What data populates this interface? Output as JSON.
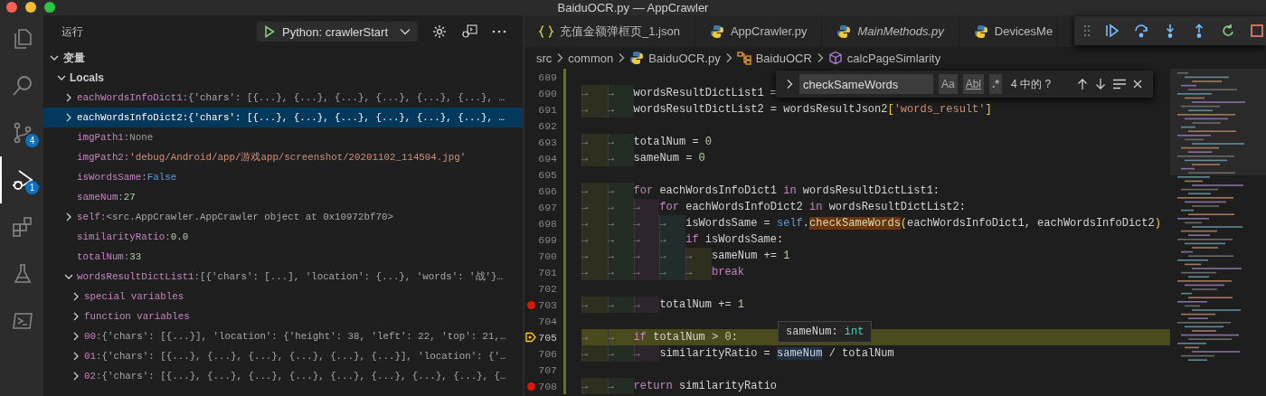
{
  "window": {
    "title": "BaiduOCR.py — AppCrawler"
  },
  "activity_bar": [
    {
      "kind": "files",
      "selected": false
    },
    {
      "kind": "search",
      "selected": false
    },
    {
      "kind": "source-control",
      "selected": false,
      "badge": "4"
    },
    {
      "kind": "run-debug",
      "selected": true,
      "badge": "1"
    },
    {
      "kind": "extensions",
      "selected": false
    },
    {
      "kind": "testing",
      "selected": false
    },
    {
      "kind": "remote",
      "selected": false
    }
  ],
  "run_view": {
    "title": "运行",
    "config": "Python: crawlerStart"
  },
  "variables": {
    "title": "变量",
    "expanded": true,
    "scopes": [
      {
        "name": "Locals",
        "kind": "scope",
        "expandable": true,
        "expanded": true,
        "selected": false,
        "children": [
          {
            "name": "eachWordsInfoDict1:",
            "value": "{'chars': [{...}, {...}, {...}, {...}, {...}, {...}, …",
            "kind": "object",
            "expandable": true,
            "expanded": false,
            "selected": false
          },
          {
            "name": "eachWordsInfoDict2:",
            "value": "{'chars': [{...}, {...}, {...}, {...}, {...}, {...}, …",
            "kind": "object",
            "expandable": true,
            "expanded": false,
            "selected": true
          },
          {
            "name": "imgPath1:",
            "value": "None",
            "kind": "none",
            "expandable": false,
            "selected": false
          },
          {
            "name": "imgPath2:",
            "value": "'debug/Android/app/游戏app/screenshot/20201102_114504.jpg'",
            "kind": "string",
            "expandable": false,
            "selected": false
          },
          {
            "name": "isWordsSame:",
            "value": "False",
            "kind": "bool",
            "expandable": false,
            "selected": false
          },
          {
            "name": "sameNum:",
            "value": "27",
            "kind": "number",
            "expandable": false,
            "selected": false
          },
          {
            "name": "self:",
            "value": "<src.AppCrawler.AppCrawler object at 0x10972bf70>",
            "kind": "object",
            "expandable": true,
            "expanded": false,
            "selected": false
          },
          {
            "name": "similarityRatio:",
            "value": "0.0",
            "kind": "number",
            "expandable": false,
            "selected": false
          },
          {
            "name": "totalNum:",
            "value": "33",
            "kind": "number",
            "expandable": false,
            "selected": false
          },
          {
            "name": "wordsResultDictList1:",
            "value": "[{'chars': [...], 'location': {...}, 'words': '战'}…",
            "kind": "object",
            "expandable": true,
            "expanded": true,
            "selected": false,
            "children": [
              {
                "name": "special variables",
                "kind": "group",
                "expandable": true,
                "expanded": false,
                "selected": false
              },
              {
                "name": "function variables",
                "kind": "group",
                "expandable": true,
                "expanded": false,
                "selected": false
              },
              {
                "name": "00:",
                "value": "{'chars': [{...}], 'location': {'height': 38, 'left': 22, 'top': 21,…",
                "kind": "object",
                "expandable": true,
                "expanded": false,
                "selected": false
              },
              {
                "name": "01:",
                "value": "{'chars': [{...}, {...}, {...}, {...}, {...}, {...}], 'location': {'…",
                "kind": "object",
                "expandable": true,
                "expanded": false,
                "selected": false
              },
              {
                "name": "02:",
                "value": "{'chars': [{...}, {...}, {...}, {...}, {...}, {...}, {...}, {...}, {…",
                "kind": "object",
                "expandable": true,
                "expanded": false,
                "selected": false
              }
            ]
          }
        ]
      }
    ]
  },
  "tabs": [
    {
      "label": "充值金额弹框页_1.json",
      "kind": "json",
      "preview": false,
      "selected": false
    },
    {
      "label": "AppCrawler.py",
      "kind": "python",
      "preview": false,
      "selected": false
    },
    {
      "label": "MainMethods.py",
      "kind": "python",
      "preview": true,
      "selected": false
    },
    {
      "label": "DevicesMe",
      "kind": "python",
      "preview": false,
      "selected": false
    }
  ],
  "breadcrumbs": [
    {
      "label": "src",
      "kind": "folder"
    },
    {
      "label": "common",
      "kind": "folder"
    },
    {
      "label": "BaiduOCR.py",
      "kind": "python"
    },
    {
      "label": "BaiduOCR",
      "kind": "class"
    },
    {
      "label": "calcPageSimlarity",
      "kind": "method"
    }
  ],
  "find_widget": {
    "query": "checkSameWords",
    "options": [
      {
        "label": "Aa",
        "kind": "case"
      },
      {
        "label": "Abl",
        "kind": "word"
      },
      {
        "label": ".*",
        "kind": "regex"
      }
    ],
    "result": "4 中的 ?"
  },
  "code_lines": [
    {
      "number": "689",
      "breakpoint": false,
      "current": false
    },
    {
      "number": "690",
      "breakpoint": false,
      "current": false,
      "tokens": [
        {
          "kind": "tab",
          "text": "→"
        },
        {
          "kind": "tab",
          "text": "→"
        },
        {
          "kind": "plain",
          "text": "wordsResultDictList1 ="
        }
      ]
    },
    {
      "number": "691",
      "breakpoint": false,
      "current": false,
      "tokens": [
        {
          "kind": "tab",
          "text": "→"
        },
        {
          "kind": "tab",
          "text": "→"
        },
        {
          "kind": "plain",
          "text": "wordsResultDictList2 = wordsResultJson2"
        },
        {
          "kind": "bracket",
          "text": "["
        },
        {
          "kind": "string",
          "text": "'words_result'"
        },
        {
          "kind": "bracket",
          "text": "]"
        }
      ]
    },
    {
      "number": "692",
      "breakpoint": false,
      "current": false
    },
    {
      "number": "693",
      "breakpoint": false,
      "current": false,
      "tokens": [
        {
          "kind": "tab",
          "text": "→"
        },
        {
          "kind": "tab",
          "text": "→"
        },
        {
          "kind": "plain",
          "text": "totalNum = "
        },
        {
          "kind": "number",
          "text": "0"
        }
      ]
    },
    {
      "number": "694",
      "breakpoint": false,
      "current": false,
      "tokens": [
        {
          "kind": "tab",
          "text": "→"
        },
        {
          "kind": "tab",
          "text": "→"
        },
        {
          "kind": "plain",
          "text": "sameNum = "
        },
        {
          "kind": "number",
          "text": "0"
        }
      ]
    },
    {
      "number": "695",
      "breakpoint": false,
      "current": false
    },
    {
      "number": "696",
      "breakpoint": false,
      "current": false,
      "tokens": [
        {
          "kind": "tab",
          "text": "→"
        },
        {
          "kind": "tab",
          "text": "→"
        },
        {
          "kind": "keyword",
          "text": "for"
        },
        {
          "kind": "plain",
          "text": " eachWordsInfoDict1 "
        },
        {
          "kind": "keyword",
          "text": "in"
        },
        {
          "kind": "plain",
          "text": " wordsResultDictList1:"
        }
      ]
    },
    {
      "number": "697",
      "breakpoint": false,
      "current": false,
      "tokens": [
        {
          "kind": "tab",
          "text": "→"
        },
        {
          "kind": "tab",
          "text": "→"
        },
        {
          "kind": "tab",
          "text": "→"
        },
        {
          "kind": "keyword",
          "text": "for"
        },
        {
          "kind": "plain",
          "text": " eachWordsInfoDict2 "
        },
        {
          "kind": "keyword",
          "text": "in"
        },
        {
          "kind": "plain",
          "text": " wordsResultDictList2:"
        }
      ]
    },
    {
      "number": "698",
      "breakpoint": false,
      "current": false,
      "tokens": [
        {
          "kind": "tab",
          "text": "→"
        },
        {
          "kind": "tab",
          "text": "→"
        },
        {
          "kind": "tab",
          "text": "→"
        },
        {
          "kind": "tab",
          "text": "→"
        },
        {
          "kind": "plain",
          "text": "isWordsSame = "
        },
        {
          "kind": "self",
          "text": "self"
        },
        {
          "kind": "plain",
          "text": "."
        },
        {
          "kind": "match",
          "text": "checkSameWords"
        },
        {
          "kind": "bracket",
          "text": "("
        },
        {
          "kind": "plain",
          "text": "eachWordsInfoDict1, eachWordsInfoDict2"
        },
        {
          "kind": "bracket",
          "text": ")"
        }
      ]
    },
    {
      "number": "699",
      "breakpoint": false,
      "current": false,
      "tokens": [
        {
          "kind": "tab",
          "text": "→"
        },
        {
          "kind": "tab",
          "text": "→"
        },
        {
          "kind": "tab",
          "text": "→"
        },
        {
          "kind": "tab",
          "text": "→"
        },
        {
          "kind": "keyword",
          "text": "if"
        },
        {
          "kind": "plain",
          "text": " isWordsSame:"
        }
      ]
    },
    {
      "number": "700",
      "breakpoint": false,
      "current": false,
      "tokens": [
        {
          "kind": "tab",
          "text": "→"
        },
        {
          "kind": "tab",
          "text": "→"
        },
        {
          "kind": "tab",
          "text": "→"
        },
        {
          "kind": "tab",
          "text": "→"
        },
        {
          "kind": "tab",
          "text": "→"
        },
        {
          "kind": "plain",
          "text": "sameNum += "
        },
        {
          "kind": "number",
          "text": "1"
        }
      ]
    },
    {
      "number": "701",
      "breakpoint": false,
      "current": false,
      "tokens": [
        {
          "kind": "tab",
          "text": "→"
        },
        {
          "kind": "tab",
          "text": "→"
        },
        {
          "kind": "tab",
          "text": "→"
        },
        {
          "kind": "tab",
          "text": "→"
        },
        {
          "kind": "tab",
          "text": "→"
        },
        {
          "kind": "keyword",
          "text": "break"
        }
      ]
    },
    {
      "number": "702",
      "breakpoint": false,
      "current": false
    },
    {
      "number": "703",
      "breakpoint": true,
      "current": false,
      "tokens": [
        {
          "kind": "tab",
          "text": "→"
        },
        {
          "kind": "tab",
          "text": "→"
        },
        {
          "kind": "tab",
          "text": "→"
        },
        {
          "kind": "plain",
          "text": "totalNum += "
        },
        {
          "kind": "number",
          "text": "1"
        }
      ]
    },
    {
      "number": "704",
      "breakpoint": false,
      "current": false
    },
    {
      "number": "705",
      "breakpoint": false,
      "current": true,
      "tokens": [
        {
          "kind": "tab",
          "text": "→"
        },
        {
          "kind": "tab",
          "text": "→"
        },
        {
          "kind": "keyword",
          "text": "if"
        },
        {
          "kind": "plain",
          "text": " totalNum > "
        },
        {
          "kind": "number",
          "text": "0"
        },
        {
          "kind": "plain",
          "text": ":"
        }
      ]
    },
    {
      "number": "706",
      "breakpoint": false,
      "current": false,
      "tokens": [
        {
          "kind": "tab",
          "text": "→"
        },
        {
          "kind": "tab",
          "text": "→"
        },
        {
          "kind": "tab",
          "text": "→"
        },
        {
          "kind": "plain",
          "text": "similarityRatio = "
        },
        {
          "kind": "hover",
          "text": "sameNum"
        },
        {
          "kind": "plain",
          "text": " / totalNum"
        }
      ]
    },
    {
      "number": "707",
      "breakpoint": false,
      "current": false
    },
    {
      "number": "708",
      "breakpoint": true,
      "current": false,
      "tokens": [
        {
          "kind": "tab",
          "text": "→"
        },
        {
          "kind": "tab",
          "text": "→"
        },
        {
          "kind": "keyword",
          "text": "return"
        },
        {
          "kind": "plain",
          "text": " similarityRatio"
        }
      ]
    }
  ],
  "hover": {
    "name": "sameNum:",
    "type": "int"
  }
}
